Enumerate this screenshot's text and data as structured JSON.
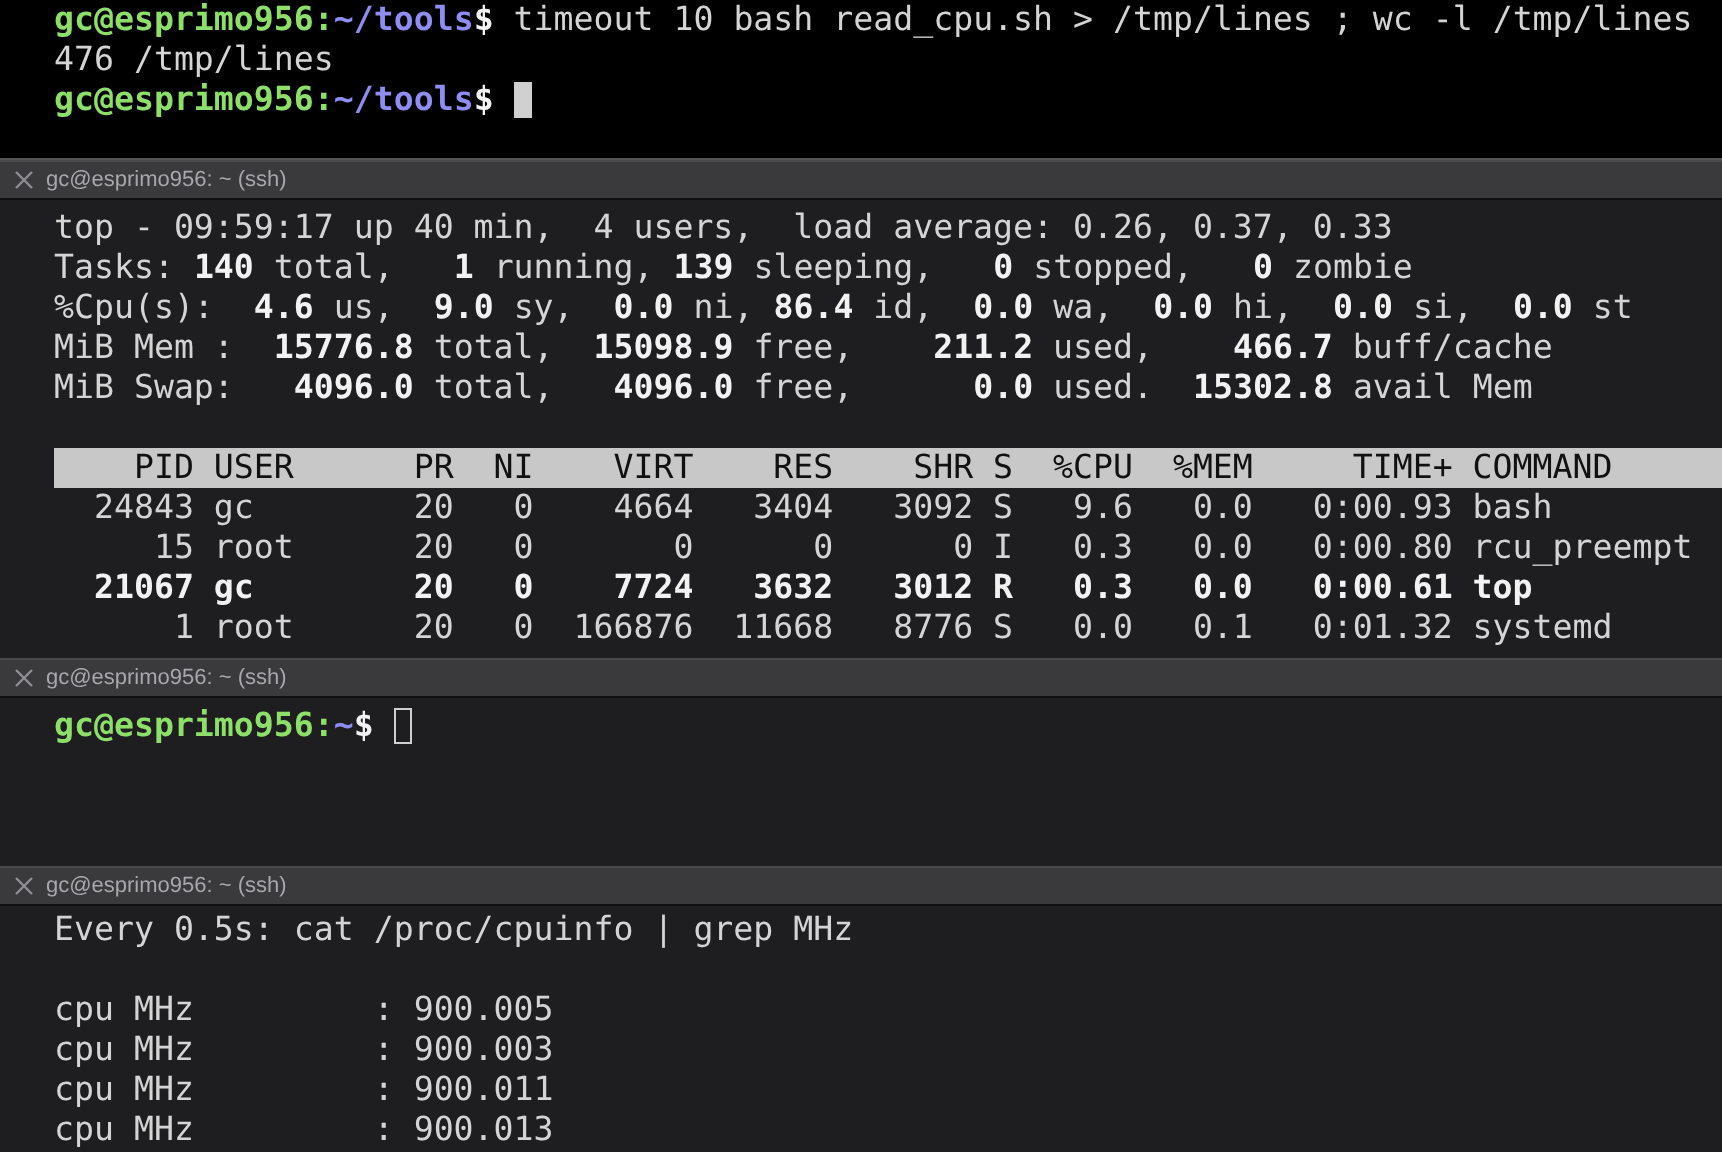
{
  "panes": [
    {
      "lines": [
        {
          "kind": "text",
          "segments": [
            {
              "text": "gc@esprimo956:",
              "kind": "user"
            },
            {
              "text": "~/tools",
              "kind": "path"
            },
            {
              "text": "$",
              "kind": "bold"
            },
            {
              "text": " timeout 10 bash read_cpu.sh > /tmp/lines ; wc -l /tmp/lines",
              "kind": "plain"
            }
          ]
        },
        {
          "kind": "text",
          "segments": [
            {
              "text": "476 /tmp/lines",
              "kind": "plain"
            }
          ]
        },
        {
          "kind": "text",
          "segments": [
            {
              "text": "gc@esprimo956:",
              "kind": "user"
            },
            {
              "text": "~/tools",
              "kind": "path"
            },
            {
              "text": "$",
              "kind": "bold"
            }
          ],
          "cursor": {
            "focused": true
          }
        }
      ]
    },
    {
      "title": "gc@esprimo956: ~ (ssh)",
      "lines": [
        {
          "kind": "text",
          "segments": [
            {
              "text": "top - 09:59:17 up 40 min,  4 users,  load average: 0.26, 0.37, 0.33",
              "kind": "plain"
            }
          ]
        },
        {
          "kind": "text",
          "segments": [
            {
              "text": "Tasks: ",
              "kind": "plain"
            },
            {
              "text": "140",
              "kind": "bold"
            },
            {
              "text": " total,   ",
              "kind": "plain"
            },
            {
              "text": "1",
              "kind": "bold"
            },
            {
              "text": " running, ",
              "kind": "plain"
            },
            {
              "text": "139",
              "kind": "bold"
            },
            {
              "text": " sleeping,   ",
              "kind": "plain"
            },
            {
              "text": "0",
              "kind": "bold"
            },
            {
              "text": " stopped,   ",
              "kind": "plain"
            },
            {
              "text": "0",
              "kind": "bold"
            },
            {
              "text": " zombie",
              "kind": "plain"
            }
          ]
        },
        {
          "kind": "text",
          "segments": [
            {
              "text": "%Cpu(s):  ",
              "kind": "plain"
            },
            {
              "text": "4.6",
              "kind": "bold"
            },
            {
              "text": " us,  ",
              "kind": "plain"
            },
            {
              "text": "9.0",
              "kind": "bold"
            },
            {
              "text": " sy,  ",
              "kind": "plain"
            },
            {
              "text": "0.0",
              "kind": "bold"
            },
            {
              "text": " ni, ",
              "kind": "plain"
            },
            {
              "text": "86.4",
              "kind": "bold"
            },
            {
              "text": " id,  ",
              "kind": "plain"
            },
            {
              "text": "0.0",
              "kind": "bold"
            },
            {
              "text": " wa,  ",
              "kind": "plain"
            },
            {
              "text": "0.0",
              "kind": "bold"
            },
            {
              "text": " hi,  ",
              "kind": "plain"
            },
            {
              "text": "0.0",
              "kind": "bold"
            },
            {
              "text": " si,  ",
              "kind": "plain"
            },
            {
              "text": "0.0",
              "kind": "bold"
            },
            {
              "text": " st",
              "kind": "plain"
            }
          ]
        },
        {
          "kind": "text",
          "segments": [
            {
              "text": "MiB Mem :  ",
              "kind": "plain"
            },
            {
              "text": "15776.8",
              "kind": "bold"
            },
            {
              "text": " total,  ",
              "kind": "plain"
            },
            {
              "text": "15098.9",
              "kind": "bold"
            },
            {
              "text": " free,    ",
              "kind": "plain"
            },
            {
              "text": "211.2",
              "kind": "bold"
            },
            {
              "text": " used,    ",
              "kind": "plain"
            },
            {
              "text": "466.7",
              "kind": "bold"
            },
            {
              "text": " buff/cache",
              "kind": "plain"
            }
          ]
        },
        {
          "kind": "text",
          "segments": [
            {
              "text": "MiB Swap:   ",
              "kind": "plain"
            },
            {
              "text": "4096.0",
              "kind": "bold"
            },
            {
              "text": " total,   ",
              "kind": "plain"
            },
            {
              "text": "4096.0",
              "kind": "bold"
            },
            {
              "text": " free,      ",
              "kind": "plain"
            },
            {
              "text": "0.0",
              "kind": "bold"
            },
            {
              "text": " used.  ",
              "kind": "plain"
            },
            {
              "text": "15302.8",
              "kind": "bold"
            },
            {
              "text": " avail Mem",
              "kind": "plain"
            }
          ]
        },
        {
          "kind": "blank"
        },
        {
          "kind": "header",
          "segments": [
            {
              "text": "    PID USER      PR  NI    VIRT    RES    SHR S  %CPU  %MEM     TIME+ COMMAND",
              "kind": "plain"
            }
          ]
        },
        {
          "kind": "text",
          "segments": [
            {
              "text": "  24843 gc        20   0    4664   3404   3092 S   9.6   0.0   0:00.93 bash",
              "kind": "plain"
            }
          ]
        },
        {
          "kind": "text",
          "segments": [
            {
              "text": "     15 root      20   0       0      0      0 I   0.3   0.0   0:00.80 rcu_preempt",
              "kind": "plain"
            }
          ]
        },
        {
          "kind": "text",
          "segments": [
            {
              "text": "  21067 gc        20   0    7724   3632   3012 R   0.3   0.0   0:00.61 top",
              "kind": "bold"
            }
          ]
        },
        {
          "kind": "text",
          "segments": [
            {
              "text": "      1 root      20   0  166876  11668   8776 S   0.0   0.1   0:01.32 systemd",
              "kind": "plain"
            }
          ]
        }
      ]
    },
    {
      "title": "gc@esprimo956: ~ (ssh)",
      "lines": [
        {
          "kind": "text",
          "segments": [
            {
              "text": "gc@esprimo956:",
              "kind": "user"
            },
            {
              "text": "~",
              "kind": "path"
            },
            {
              "text": "$",
              "kind": "bold"
            }
          ],
          "cursor": {
            "focused": false
          }
        }
      ]
    },
    {
      "title": "gc@esprimo956: ~ (ssh)",
      "lines": [
        {
          "kind": "text",
          "segments": [
            {
              "text": "Every 0.5s: cat /proc/cpuinfo | grep MHz",
              "kind": "plain"
            }
          ]
        },
        {
          "kind": "blank"
        },
        {
          "kind": "text",
          "segments": [
            {
              "text": "cpu MHz         : 900.005",
              "kind": "plain"
            }
          ]
        },
        {
          "kind": "text",
          "segments": [
            {
              "text": "cpu MHz         : 900.003",
              "kind": "plain"
            }
          ]
        },
        {
          "kind": "text",
          "segments": [
            {
              "text": "cpu MHz         : 900.011",
              "kind": "plain"
            }
          ]
        },
        {
          "kind": "text",
          "segments": [
            {
              "text": "cpu MHz         : 900.013",
              "kind": "plain"
            }
          ]
        }
      ]
    }
  ]
}
